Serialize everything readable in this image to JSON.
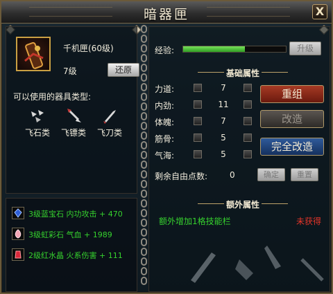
{
  "window": {
    "title": "暗器匣",
    "close_label": "X"
  },
  "item": {
    "name": "千机匣(60级)",
    "level": "7级",
    "restore_label": "还原"
  },
  "types": {
    "label": "可以使用的器具类型:",
    "list": [
      {
        "name": "飞石类",
        "icon": "flying-stone-icon"
      },
      {
        "name": "飞镖类",
        "icon": "dart-icon"
      },
      {
        "name": "飞刀类",
        "icon": "throwing-knife-icon"
      }
    ]
  },
  "gems": [
    {
      "text": "3级蓝宝石 内功攻击 + 470",
      "icon": "sapphire-icon",
      "color": "#2f5fd6"
    },
    {
      "text": "3级虹彩石 气血 + 1989",
      "icon": "rainbow-stone-icon",
      "color": "#f4a6b4"
    },
    {
      "text": "2级红水晶 火系伤害 + 111",
      "icon": "red-crystal-icon",
      "color": "#d8283a"
    }
  ],
  "exp": {
    "label": "经验:",
    "progress": 0.6,
    "upgrade_label": "升级"
  },
  "base_attrs": {
    "title": "基础属性",
    "rows": [
      {
        "label": "力道:",
        "value": "7"
      },
      {
        "label": "内劲:",
        "value": "11"
      },
      {
        "label": "体魄:",
        "value": "7"
      },
      {
        "label": "筋骨:",
        "value": "5"
      },
      {
        "label": "气海:",
        "value": "5"
      }
    ],
    "free_points_label": "剩余自由点数:",
    "free_points": "0",
    "confirm_label": "确定",
    "reset_label": "重置"
  },
  "actions": {
    "regroup": "重组",
    "modify": "改造",
    "full_modify": "完全改造"
  },
  "extra_attrs": {
    "title": "额外属性",
    "text": "额外增加1格技能栏",
    "status": "未获得"
  },
  "colors": {
    "exp_green": "#2e9e23",
    "extra_green": "#36d22e",
    "status_red": "#e5352a",
    "border_gold": "#caa043"
  }
}
